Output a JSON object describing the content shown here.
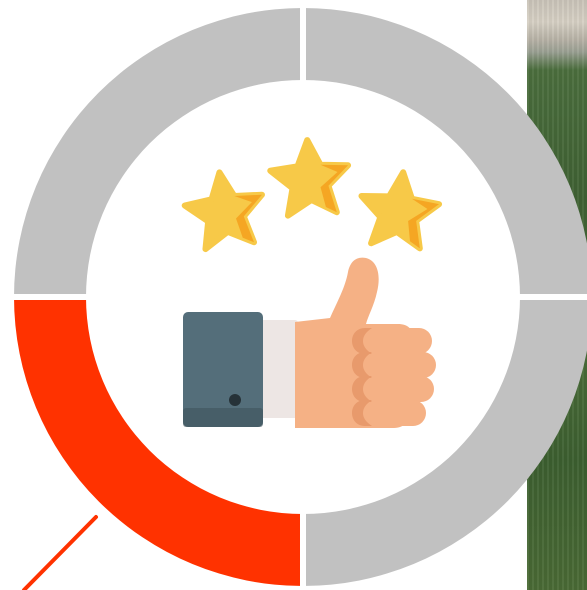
{
  "colors": {
    "page_background": "#ffffff",
    "segment_inactive": "#c1c1c1",
    "segment_active": "#ff3200",
    "center_disc": "#ffffff",
    "star_fill": "#f7c948",
    "star_shade": "#f5a623",
    "cuff": "#546e7a",
    "cuff_button": "#263238",
    "sleeve": "#ede6e4",
    "hand": "#f5b185",
    "hand_shade": "#e89a6c",
    "pointer_line": "#ff3200"
  },
  "ring": {
    "segments": [
      {
        "name": "top-left",
        "active": false
      },
      {
        "name": "top-right",
        "active": false
      },
      {
        "name": "bottom-right",
        "active": false
      },
      {
        "name": "bottom-left",
        "active": true
      }
    ]
  },
  "icons": {
    "center": "thumbs-up-with-three-stars-icon",
    "stars": [
      "star-icon",
      "star-icon",
      "star-icon"
    ]
  }
}
